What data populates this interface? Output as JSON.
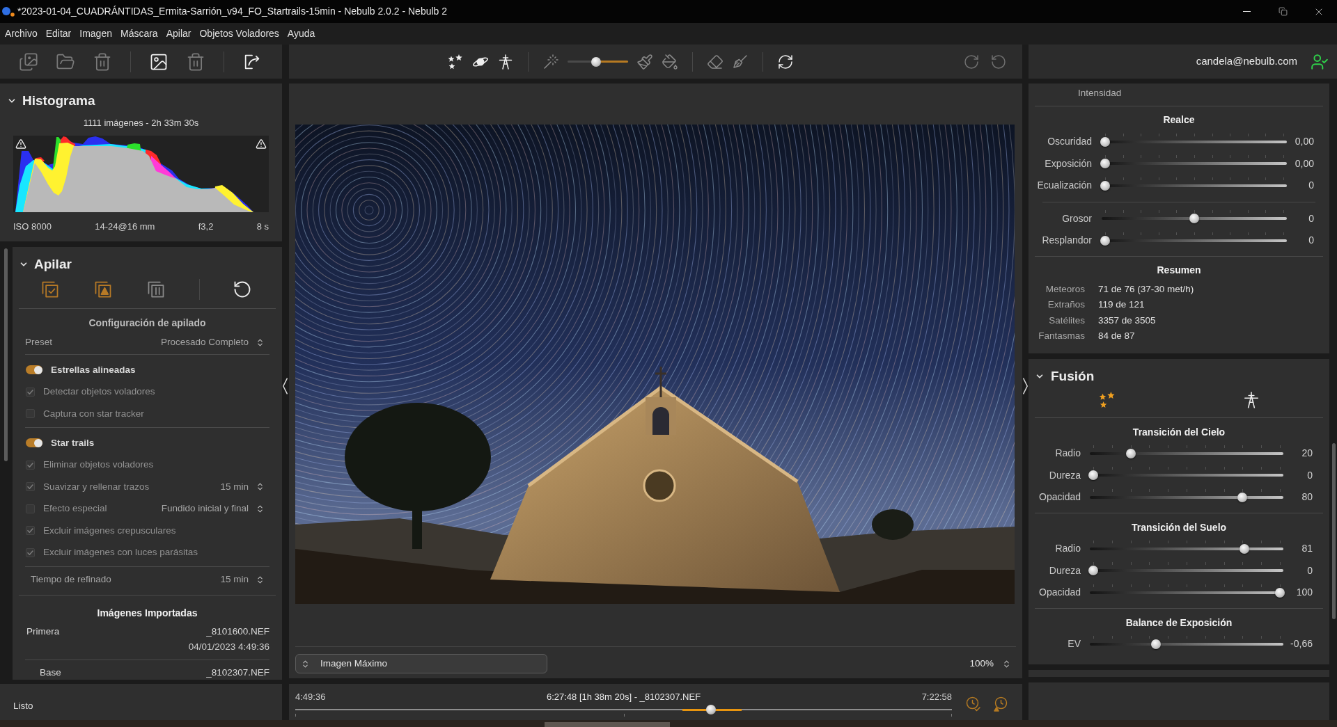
{
  "window": {
    "title": "*2023-01-04_CUADRÁNTIDAS_Ermita-Sarrión_v94_FO_Startrails-15min - Nebulb 2.0.2 - Nebulb 2"
  },
  "menu": [
    "Archivo",
    "Editar",
    "Imagen",
    "Máscara",
    "Apilar",
    "Objetos Voladores",
    "Ayuda"
  ],
  "file_toolbar": {
    "groups": [
      [
        {
          "kind": "images",
          "disabled": true
        },
        {
          "kind": "folder",
          "disabled": true
        },
        {
          "kind": "trash",
          "disabled": true
        }
      ],
      [
        {
          "kind": "image",
          "disabled": false
        },
        {
          "kind": "trash",
          "disabled": true
        }
      ],
      [
        {
          "kind": "export",
          "disabled": false
        }
      ]
    ]
  },
  "edit_toolbar": {
    "groups": [
      [
        {
          "kind": "stars",
          "disabled": false
        },
        {
          "kind": "planet",
          "disabled": false
        },
        {
          "kind": "tower",
          "disabled": false
        }
      ],
      [
        {
          "kind": "wand",
          "disabled": true
        },
        {
          "kind": "slider",
          "level": 0.47
        },
        {
          "kind": "brush",
          "disabled": true
        },
        {
          "kind": "bucket",
          "disabled": true
        }
      ],
      [
        {
          "kind": "eraser",
          "disabled": true
        },
        {
          "kind": "broom",
          "disabled": true
        }
      ],
      [
        {
          "kind": "refresh",
          "disabled": false
        }
      ]
    ],
    "history": [
      {
        "kind": "redo",
        "disabled": true
      },
      {
        "kind": "undo",
        "disabled": true
      }
    ]
  },
  "account": {
    "email": "candela@nebulb.com"
  },
  "histogram": {
    "title": "Histograma",
    "expanded": true,
    "summary": "1111 imágenes - 2h 33m 30s",
    "exif": [
      "ISO 8000",
      "14-24@16 mm",
      "f3,2",
      "8 s"
    ]
  },
  "stack": {
    "title": "Apilar",
    "expanded": true,
    "modes": [
      {
        "kind": "stack-check",
        "active": true
      },
      {
        "kind": "stack-triangle",
        "active": true
      },
      {
        "kind": "stack-bars",
        "active": false
      }
    ],
    "section_title": "Configuración de apilado",
    "preset": {
      "label": "Preset",
      "value": "Procesado Completo"
    },
    "groups": [
      {
        "label": "Estrellas alineadas",
        "on": true,
        "options": [
          {
            "label": "Detectar objetos voladores",
            "checked": true,
            "disabled": true
          },
          {
            "label": "Captura con star tracker",
            "checked": false,
            "disabled": true
          }
        ]
      },
      {
        "label": "Star trails",
        "on": true,
        "options": [
          {
            "label": "Eliminar objetos voladores",
            "checked": true,
            "disabled": true
          },
          {
            "label": "Suavizar y rellenar trazos",
            "checked": true,
            "disabled": true,
            "value": "15 min"
          },
          {
            "label": "Efecto especial",
            "checked": false,
            "disabled": true,
            "value": "Fundido inicial y final"
          },
          {
            "label": "Excluir imágenes crepusculares",
            "checked": true,
            "disabled": true
          },
          {
            "label": "Excluir imágenes con luces parásitas",
            "checked": true,
            "disabled": true
          }
        ]
      }
    ],
    "refine": {
      "label": "Tiempo de refinado",
      "value": "15 min"
    },
    "imports": {
      "title": "Imágenes Importadas",
      "rows": [
        {
          "label": "Primera",
          "file": "_8101600.NEF",
          "date": "04/01/2023 4:49:36"
        },
        {
          "label": "Base",
          "file": "_8102307.NEF"
        }
      ]
    }
  },
  "status_bar": {
    "text": "Listo"
  },
  "viewer": {
    "image_selector": {
      "value": "Imagen Máximo"
    },
    "zoom": "100%"
  },
  "timeline": {
    "start": "4:49:36",
    "current": "6:27:48 [1h 38m 20s] - _8102307.NEF",
    "end": "7:22:58",
    "level": 0.635
  },
  "intensity": {
    "heading": "Intensidad",
    "title": "Realce",
    "slider_groups": [
      [
        {
          "label": "Oscuridad",
          "value": "0,00",
          "level": 0
        },
        {
          "label": "Exposición",
          "value": "0,00",
          "level": 0
        },
        {
          "label": "Ecualización",
          "value": "0",
          "level": 0
        }
      ],
      [
        {
          "label": "Grosor",
          "value": "0",
          "level": 0.5
        },
        {
          "label": "Resplandor",
          "value": "0",
          "level": 0
        }
      ]
    ],
    "summary": {
      "title": "Resumen",
      "rows": [
        {
          "label": "Meteoros",
          "value": "71 de 76 (37-30 met/h)"
        },
        {
          "label": "Extraños",
          "value": "119 de 121"
        },
        {
          "label": "Satélites",
          "value": "3357 de 3505"
        },
        {
          "label": "Fantasmas",
          "value": "84 de 87"
        }
      ]
    }
  },
  "fusion": {
    "title": "Fusión",
    "expanded": true,
    "tabs": [
      {
        "kind": "stars",
        "selected": true
      },
      {
        "kind": "tower",
        "selected": false
      }
    ],
    "sections": [
      {
        "title": "Transición del Cielo",
        "sliders": [
          {
            "label": "Radio",
            "value": "20",
            "level": 0.2
          },
          {
            "label": "Dureza",
            "value": "0",
            "level": 0
          },
          {
            "label": "Opacidad",
            "value": "80",
            "level": 0.8
          }
        ]
      },
      {
        "title": "Transición del Suelo",
        "sliders": [
          {
            "label": "Radio",
            "value": "81",
            "level": 0.81
          },
          {
            "label": "Dureza",
            "value": "0",
            "level": 0
          },
          {
            "label": "Opacidad",
            "value": "100",
            "level": 1
          }
        ]
      },
      {
        "title": "Balance de Exposición",
        "sliders": [
          {
            "label": "EV",
            "value": "-0,66",
            "level": 0.336
          }
        ]
      }
    ]
  }
}
